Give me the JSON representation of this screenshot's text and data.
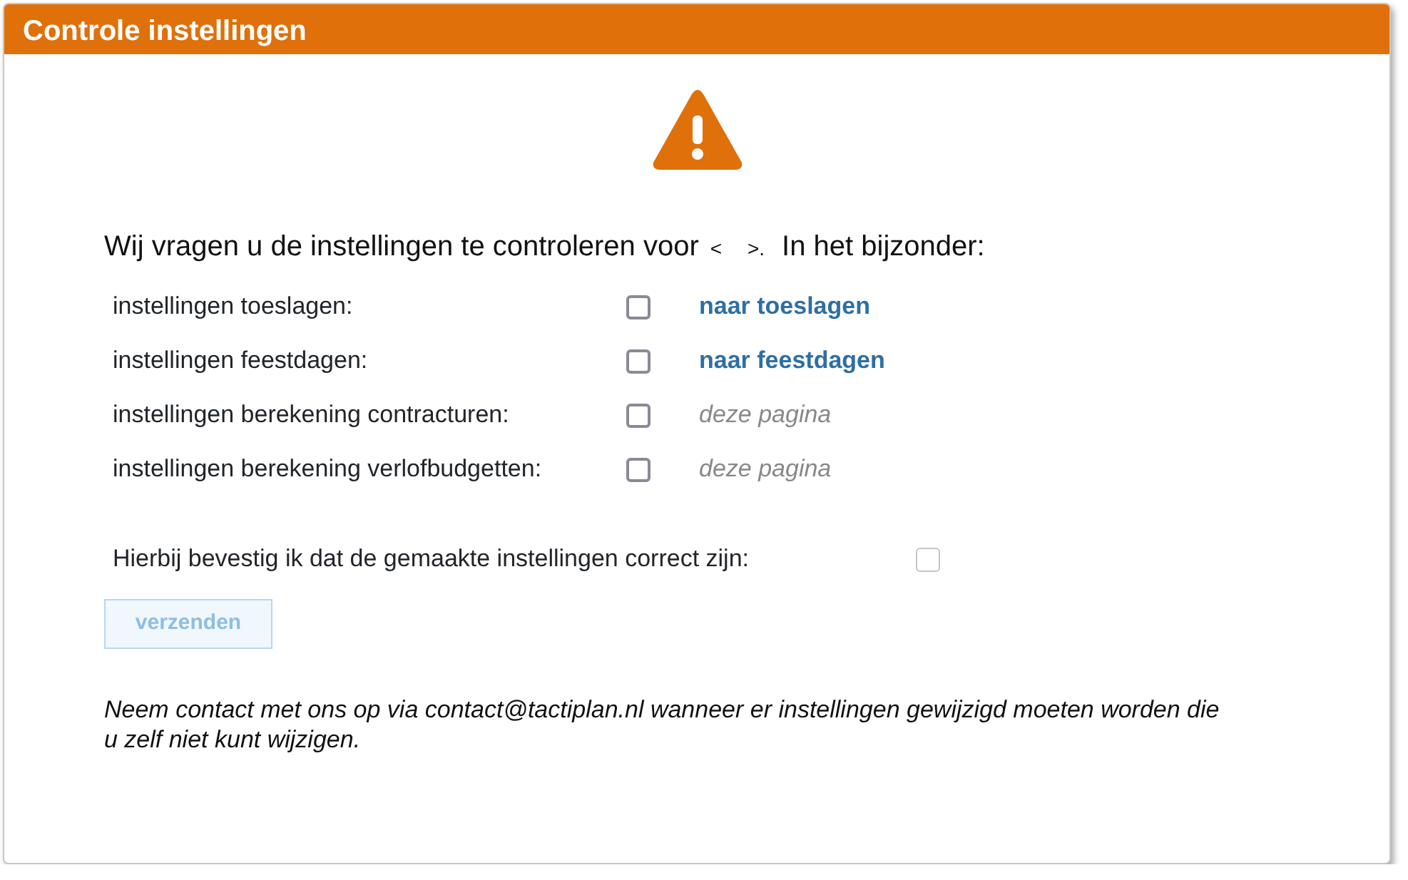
{
  "window": {
    "title": "Controle instellingen"
  },
  "intro": {
    "text": "Wij vragen u de instellingen te controleren voor",
    "name_slot": "< >.",
    "after": "In het bijzonder:"
  },
  "settings": [
    {
      "label": "instellingen toeslagen:",
      "checked": false,
      "kind": "link",
      "action": "naar toeslagen"
    },
    {
      "label": "instellingen feestdagen:",
      "checked": false,
      "kind": "link",
      "action": "naar feestdagen"
    },
    {
      "label": "instellingen berekening contracturen:",
      "checked": false,
      "kind": "note",
      "action": "deze pagina"
    },
    {
      "label": "instellingen berekening verlofbudgetten:",
      "checked": false,
      "kind": "note",
      "action": "deze pagina"
    }
  ],
  "confirm": {
    "label": "Hierbij bevestig ik dat de gemaakte instellingen correct zijn:",
    "checked": false
  },
  "submit": {
    "label": "verzenden",
    "disabled": true
  },
  "footer": "Neem contact met ons op via contact@tactiplan.nl wanneer er instellingen gewijzigd moeten worden die u zelf niet kunt wijzigen."
}
